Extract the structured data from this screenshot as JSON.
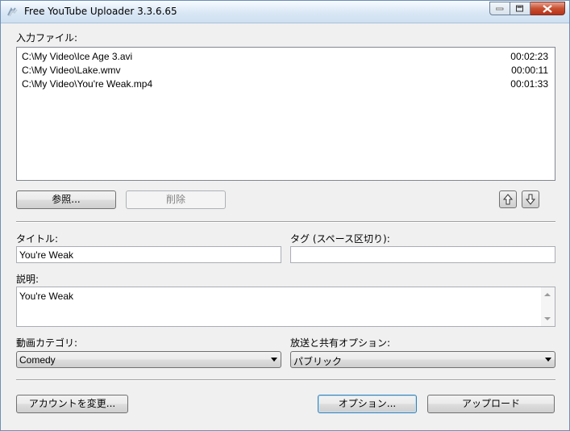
{
  "window": {
    "title": "Free YouTube Uploader 3.3.6.65"
  },
  "files": {
    "label": "入力ファイル:",
    "items": [
      {
        "path": "C:\\My Video\\Ice Age 3.avi",
        "duration": "00:02:23"
      },
      {
        "path": "C:\\My Video\\Lake.wmv",
        "duration": "00:00:11"
      },
      {
        "path": "C:\\My Video\\You're Weak.mp4",
        "duration": "00:01:33"
      }
    ],
    "browse_label": "参照...",
    "delete_label": "削除"
  },
  "form": {
    "title_label": "タイトル:",
    "title_value": "You're Weak",
    "tags_label": "タグ (スペース区切り):",
    "tags_value": "",
    "description_label": "説明:",
    "description_value": "You're Weak",
    "category_label": "動画カテゴリ:",
    "category_value": "Comedy",
    "privacy_label": "放送と共有オプション:",
    "privacy_value": "パブリック"
  },
  "footer": {
    "account_label": "アカウントを変更...",
    "options_label": "オプション...",
    "upload_label": "アップロード"
  }
}
